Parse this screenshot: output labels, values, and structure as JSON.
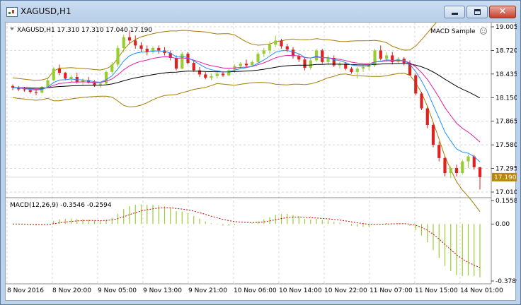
{
  "window": {
    "title": "XAGUSD,H1",
    "close_glyph": "✕"
  },
  "price_panel": {
    "header": "XAGUSD,H1  17.310 17.310 17.040 17.190",
    "indicator_label": "MACD Sample",
    "current_price": "17.190",
    "y_ticks": [
      "19.005",
      "18.720",
      "18.435",
      "18.150",
      "17.865",
      "17.580",
      "17.295",
      "17.010"
    ]
  },
  "macd_panel": {
    "header": "MACD(12,26,9) -0.3546 -0.2594",
    "y_ticks": [
      "0.1558",
      "0.00",
      "-0.3789"
    ]
  },
  "x_ticks": [
    "8 Nov 2016",
    "8 Nov 20:00",
    "9 Nov 05:00",
    "9 Nov 13:00",
    "9 Nov 21:00",
    "10 Nov 06:00",
    "10 Nov 14:00",
    "10 Nov 22:00",
    "11 Nov 07:00",
    "11 Nov 15:00",
    "14 Nov 01:00"
  ],
  "colors": {
    "bull": "#9acd32",
    "bear": "#dd2222",
    "bands": "#a67c00",
    "ma_fast": "#1e90ff",
    "ma_mid": "#e020a0",
    "ma_slow": "#000000",
    "signal": "#cc0000",
    "grid": "#c8c8c8",
    "price_tag": "#b8860b"
  },
  "chart_data": [
    {
      "type": "candlestick",
      "title": "XAGUSD,H1",
      "ylim": [
        17.01,
        19.005
      ],
      "x": [
        "8 Nov 2016",
        "8 Nov 20:00",
        "9 Nov 05:00",
        "9 Nov 13:00",
        "9 Nov 21:00",
        "10 Nov 06:00",
        "10 Nov 14:00",
        "10 Nov 22:00",
        "11 Nov 07:00",
        "11 Nov 15:00",
        "14 Nov 01:00"
      ],
      "candles": [
        [
          18.29,
          18.31,
          18.24,
          18.27
        ],
        [
          18.27,
          18.29,
          18.23,
          18.25
        ],
        [
          18.25,
          18.28,
          18.22,
          18.24
        ],
        [
          18.24,
          18.27,
          18.2,
          18.22
        ],
        [
          18.22,
          18.25,
          18.18,
          18.21
        ],
        [
          18.21,
          18.29,
          18.2,
          18.28
        ],
        [
          18.28,
          18.38,
          18.27,
          18.36
        ],
        [
          18.36,
          18.52,
          18.35,
          18.5
        ],
        [
          18.5,
          18.55,
          18.42,
          18.45
        ],
        [
          18.45,
          18.46,
          18.36,
          18.38
        ],
        [
          18.38,
          18.42,
          18.34,
          18.4
        ],
        [
          18.4,
          18.45,
          18.32,
          18.34
        ],
        [
          18.34,
          18.38,
          18.3,
          18.36
        ],
        [
          18.36,
          18.4,
          18.32,
          18.33
        ],
        [
          18.33,
          18.36,
          18.28,
          18.3
        ],
        [
          18.3,
          18.34,
          18.27,
          18.32
        ],
        [
          18.32,
          18.48,
          18.31,
          18.46
        ],
        [
          18.46,
          18.58,
          18.44,
          18.55
        ],
        [
          18.55,
          18.78,
          18.52,
          18.75
        ],
        [
          18.75,
          18.91,
          18.7,
          18.88
        ],
        [
          18.88,
          18.96,
          18.8,
          18.84
        ],
        [
          18.84,
          18.9,
          18.74,
          18.78
        ],
        [
          18.78,
          18.82,
          18.7,
          18.74
        ],
        [
          18.74,
          18.78,
          18.66,
          18.7
        ],
        [
          18.7,
          18.77,
          18.68,
          18.75
        ],
        [
          18.75,
          18.78,
          18.68,
          18.72
        ],
        [
          18.72,
          18.76,
          18.66,
          18.69
        ],
        [
          18.69,
          18.72,
          18.6,
          18.63
        ],
        [
          18.63,
          18.66,
          18.48,
          18.5
        ],
        [
          18.5,
          18.7,
          18.49,
          18.68
        ],
        [
          18.68,
          18.7,
          18.55,
          18.57
        ],
        [
          18.57,
          18.6,
          18.46,
          18.48
        ],
        [
          18.48,
          18.52,
          18.4,
          18.43
        ],
        [
          18.43,
          18.46,
          18.37,
          18.39
        ],
        [
          18.39,
          18.44,
          18.36,
          18.41
        ],
        [
          18.41,
          18.46,
          18.38,
          18.44
        ],
        [
          18.44,
          18.47,
          18.4,
          18.42
        ],
        [
          18.42,
          18.5,
          18.41,
          18.48
        ],
        [
          18.48,
          18.55,
          18.45,
          18.53
        ],
        [
          18.53,
          18.58,
          18.5,
          18.56
        ],
        [
          18.56,
          18.61,
          18.52,
          18.54
        ],
        [
          18.54,
          18.6,
          18.52,
          18.58
        ],
        [
          18.58,
          18.7,
          18.56,
          18.68
        ],
        [
          18.68,
          18.75,
          18.64,
          18.72
        ],
        [
          18.72,
          18.83,
          18.68,
          18.79
        ],
        [
          18.79,
          18.9,
          18.76,
          18.84
        ],
        [
          18.84,
          18.86,
          18.74,
          18.77
        ],
        [
          18.77,
          18.8,
          18.7,
          18.73
        ],
        [
          18.73,
          18.76,
          18.62,
          18.65
        ],
        [
          18.65,
          18.68,
          18.58,
          18.61
        ],
        [
          18.61,
          18.64,
          18.48,
          18.51
        ],
        [
          18.51,
          18.62,
          18.49,
          18.6
        ],
        [
          18.6,
          18.74,
          18.58,
          18.72
        ],
        [
          18.72,
          18.74,
          18.56,
          18.58
        ],
        [
          18.58,
          18.66,
          18.55,
          18.63
        ],
        [
          18.63,
          18.66,
          18.52,
          18.54
        ],
        [
          18.54,
          18.58,
          18.5,
          18.56
        ],
        [
          18.56,
          18.58,
          18.48,
          18.5
        ],
        [
          18.5,
          18.52,
          18.44,
          18.46
        ],
        [
          18.46,
          18.52,
          18.38,
          18.5
        ],
        [
          18.5,
          18.54,
          18.46,
          18.52
        ],
        [
          18.52,
          18.56,
          18.48,
          18.54
        ],
        [
          18.54,
          18.74,
          18.52,
          18.72
        ],
        [
          18.72,
          18.78,
          18.6,
          18.62
        ],
        [
          18.62,
          18.7,
          18.58,
          18.66
        ],
        [
          18.66,
          18.7,
          18.55,
          18.58
        ],
        [
          18.58,
          18.64,
          18.56,
          18.62
        ],
        [
          18.62,
          18.64,
          18.54,
          18.57
        ],
        [
          18.57,
          18.6,
          18.46,
          18.42
        ],
        [
          18.42,
          18.44,
          18.18,
          18.2
        ],
        [
          18.2,
          18.22,
          18.0,
          18.02
        ],
        [
          18.02,
          18.04,
          17.78,
          17.82
        ],
        [
          17.82,
          17.84,
          17.55,
          17.58
        ],
        [
          17.58,
          17.62,
          17.38,
          17.42
        ],
        [
          17.42,
          17.44,
          17.2,
          17.24
        ],
        [
          17.24,
          17.32,
          17.18,
          17.3
        ],
        [
          17.3,
          17.34,
          17.2,
          17.24
        ],
        [
          17.24,
          17.4,
          17.22,
          17.38
        ],
        [
          17.38,
          17.46,
          17.3,
          17.44
        ],
        [
          17.44,
          17.46,
          17.28,
          17.31
        ],
        [
          17.31,
          17.31,
          17.04,
          17.19
        ]
      ]
    },
    {
      "type": "bar",
      "title": "MACD(12,26,9)",
      "ylim": [
        -0.3789,
        0.1558
      ],
      "macd_last": -0.3546,
      "signal_last": -0.2594
    }
  ]
}
